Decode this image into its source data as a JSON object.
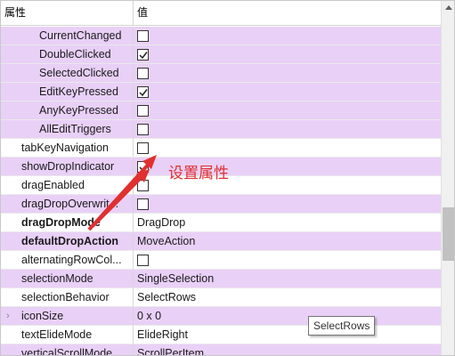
{
  "header": {
    "col_property": "属性",
    "col_value": "值"
  },
  "rows": [
    {
      "name": "CurrentChanged",
      "indent": "sub",
      "checkbox": true,
      "checked": false
    },
    {
      "name": "DoubleClicked",
      "indent": "sub",
      "checkbox": true,
      "checked": true
    },
    {
      "name": "SelectedClicked",
      "indent": "sub",
      "checkbox": true,
      "checked": false
    },
    {
      "name": "EditKeyPressed",
      "indent": "sub",
      "checkbox": true,
      "checked": true
    },
    {
      "name": "AnyKeyPressed",
      "indent": "sub",
      "checkbox": true,
      "checked": false
    },
    {
      "name": "AllEditTriggers",
      "indent": "sub",
      "checkbox": true,
      "checked": false
    },
    {
      "name": "tabKeyNavigation",
      "indent": "top",
      "checkbox": true,
      "checked": false
    },
    {
      "name": "showDropIndicator",
      "indent": "top",
      "checkbox": true,
      "checked": true
    },
    {
      "name": "dragEnabled",
      "indent": "top",
      "checkbox": true,
      "checked": false
    },
    {
      "name": "dragDropOverwrit...",
      "indent": "top",
      "checkbox": true,
      "checked": false
    },
    {
      "name": "dragDropMode",
      "indent": "top",
      "bold": true,
      "value": "DragDrop"
    },
    {
      "name": "defaultDropAction",
      "indent": "top",
      "bold": true,
      "value": "MoveAction"
    },
    {
      "name": "alternatingRowCol...",
      "indent": "top",
      "checkbox": true,
      "checked": false
    },
    {
      "name": "selectionMode",
      "indent": "top",
      "value": "SingleSelection"
    },
    {
      "name": "selectionBehavior",
      "indent": "top",
      "value": "SelectRows"
    },
    {
      "name": "iconSize",
      "indent": "top",
      "value": "0 x 0",
      "expandable": true
    },
    {
      "name": "textElideMode",
      "indent": "top",
      "value": "ElideRight"
    },
    {
      "name": "verticalScrollMode",
      "indent": "top",
      "value": "ScrollPerItem"
    }
  ],
  "tooltip": {
    "text": "SelectRows"
  },
  "annotation": {
    "text": "设置属性",
    "color": "#e03030"
  },
  "colors": {
    "highlight_row": "#e9d0f7",
    "accent_red": "#e03030"
  }
}
